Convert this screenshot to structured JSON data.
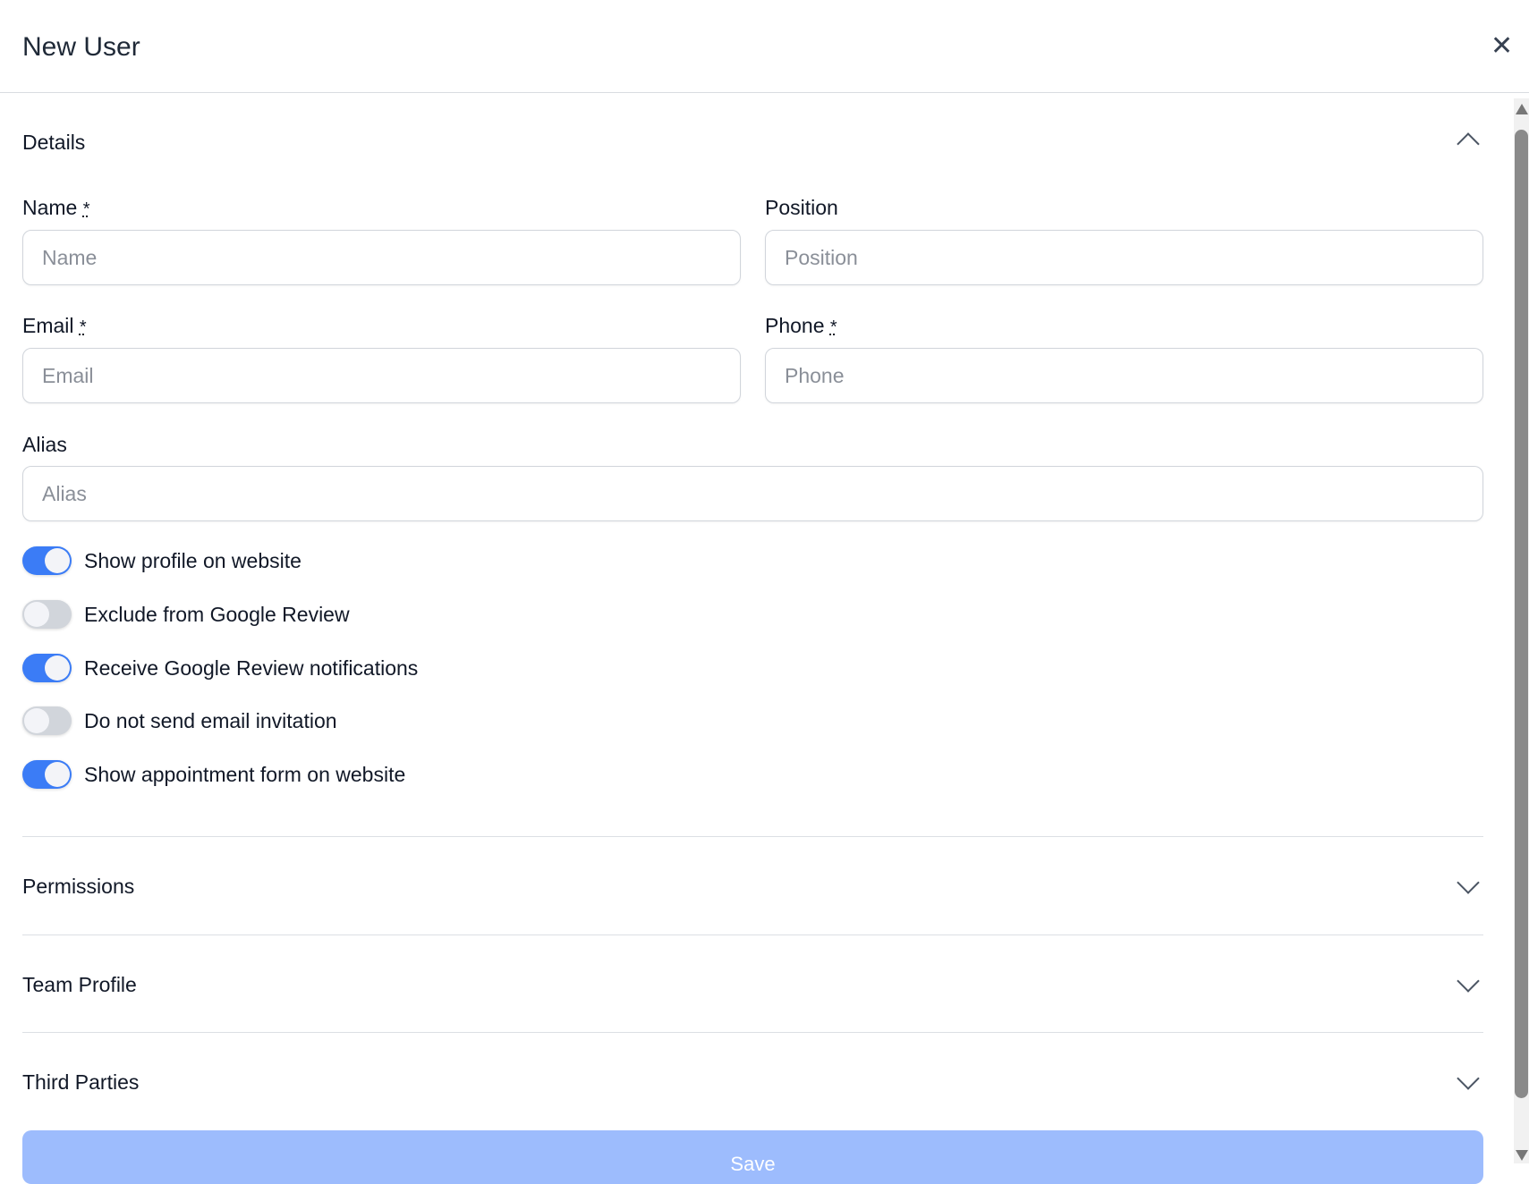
{
  "header": {
    "title": "New User",
    "close": "✕"
  },
  "details": {
    "title": "Details",
    "fields": {
      "name": {
        "label": "Name",
        "req": "*",
        "placeholder": "Name"
      },
      "position": {
        "label": "Position",
        "placeholder": "Position"
      },
      "email": {
        "label": "Email",
        "req": "*",
        "placeholder": "Email"
      },
      "phone": {
        "label": "Phone",
        "req": "*",
        "placeholder": "Phone"
      },
      "alias": {
        "label": "Alias",
        "placeholder": "Alias"
      }
    },
    "toggles": [
      {
        "label": "Show profile on website",
        "on": true
      },
      {
        "label": "Exclude from Google Review",
        "on": false
      },
      {
        "label": "Receive Google Review notifications",
        "on": true
      },
      {
        "label": "Do not send email invitation",
        "on": false
      },
      {
        "label": "Show appointment form on website",
        "on": true
      }
    ]
  },
  "sections": [
    "Permissions",
    "Team Profile",
    "Third Parties"
  ],
  "save_label": "Save",
  "colors": {
    "accent": "#3b7cf6",
    "save_disabled": "#9dbcfd"
  }
}
